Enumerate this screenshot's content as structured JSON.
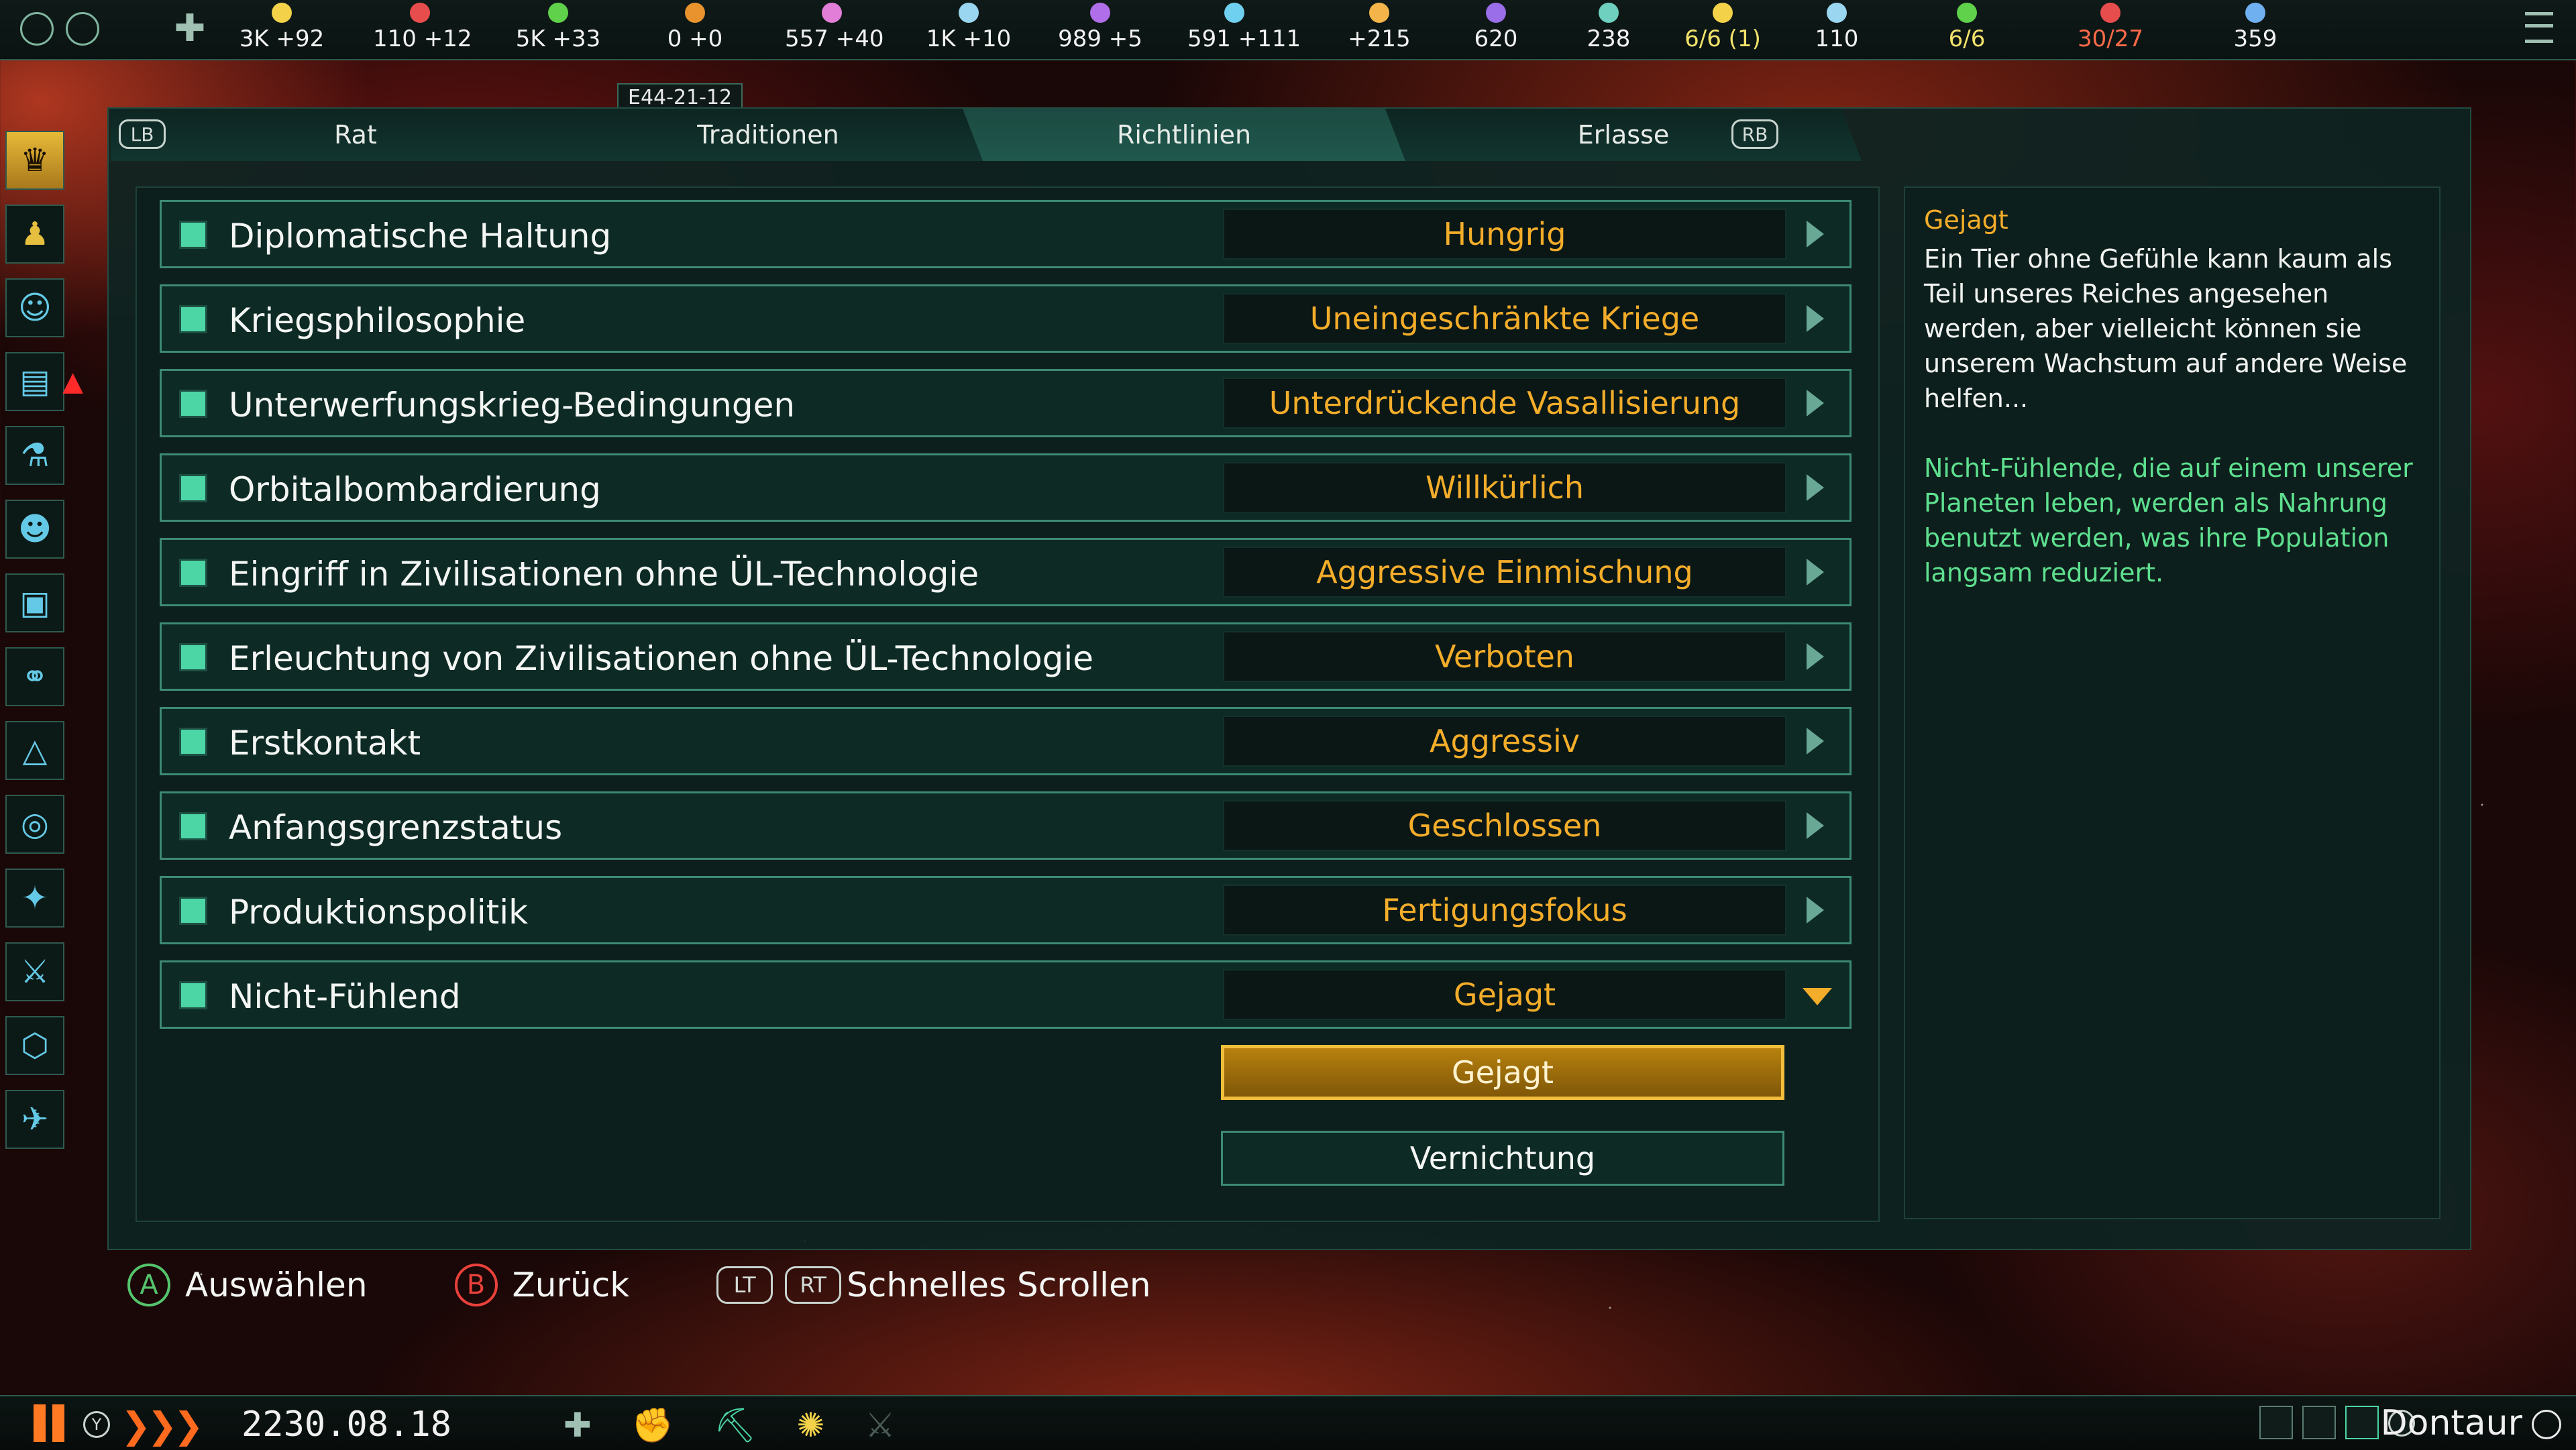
{
  "topbar": {
    "resources": [
      {
        "icon": "energy-icon",
        "text": "3K +92",
        "color": "#f3d24a"
      },
      {
        "icon": "minerals-icon",
        "text": "110 +12",
        "color": "#e84d4d"
      },
      {
        "icon": "food-icon",
        "text": "5K +33",
        "color": "#5fd14a"
      },
      {
        "icon": "consumer-goods-icon",
        "text": "0 +0",
        "color": "#e8932e"
      },
      {
        "icon": "alloys-icon",
        "text": "557 +40",
        "color": "#e27ed8"
      },
      {
        "icon": "influence-icon",
        "text": "1K +10",
        "color": "#9ad6f0"
      },
      {
        "icon": "unity-icon",
        "text": "989 +5",
        "color": "#b06ee8"
      },
      {
        "icon": "research-icon",
        "text": "591 +111",
        "color": "#6fd0f0"
      },
      {
        "icon": "strategic-icon",
        "text": "+215",
        "color": "#f3b54a"
      },
      {
        "icon": "amenities-icon",
        "text": "620",
        "color": "#9a6ee8"
      },
      {
        "icon": "stability-icon",
        "text": "238",
        "color": "#6fd0c0"
      },
      {
        "icon": "envoys-icon",
        "text": "6/6 (1)",
        "color": "#f3d24a"
      },
      {
        "icon": "pops-icon",
        "text": "110",
        "color": "#9ad6f0"
      },
      {
        "icon": "starbase-icon",
        "text": "6/6",
        "color": "#5fd14a"
      },
      {
        "icon": "fleet-icon",
        "text": "30/27",
        "color": "#e84d4d"
      },
      {
        "icon": "naval-icon",
        "text": "359",
        "color": "#6fb0f0"
      }
    ],
    "date_badge": "E44-21-12"
  },
  "tabs": {
    "lb": "LB",
    "rb": "RB",
    "items": [
      {
        "label": "Rat"
      },
      {
        "label": "Traditionen"
      },
      {
        "label": "Richtlinien",
        "active": true
      },
      {
        "label": "Erlasse"
      }
    ]
  },
  "policies": [
    {
      "name": "Diplomatische Haltung",
      "value": "Hungrig"
    },
    {
      "name": "Kriegsphilosophie",
      "value": "Uneingeschränkte Kriege"
    },
    {
      "name": "Unterwerfungskrieg-Bedingungen",
      "value": "Unterdrückende Vasallisierung"
    },
    {
      "name": "Orbitalbombardierung",
      "value": "Willkürlich"
    },
    {
      "name": "Eingriff in Zivilisationen ohne ÜL-Technologie",
      "value": "Aggressive Einmischung"
    },
    {
      "name": "Erleuchtung von Zivilisationen ohne ÜL-Technologie",
      "value": "Verboten"
    },
    {
      "name": "Erstkontakt",
      "value": "Aggressiv"
    },
    {
      "name": "Anfangsgrenzstatus",
      "value": "Geschlossen"
    },
    {
      "name": "Produktionspolitik",
      "value": "Fertigungsfokus"
    },
    {
      "name": "Nicht-Fühlend",
      "value": "Gejagt",
      "expanded": true
    }
  ],
  "dropdown_options": [
    {
      "label": "Gejagt",
      "selected": true
    },
    {
      "label": "Vernichtung",
      "selected": false
    }
  ],
  "description": {
    "title": "Gejagt",
    "text": "Ein Tier ohne Gefühle kann kaum als Teil unseres Reiches angesehen werden, aber vielleicht können sie unserem Wachstum auf andere Weise helfen...",
    "effect": "Nicht-Fühlende, die auf einem unserer Planeten leben, werden als Nahrung benutzt werden, was ihre Population langsam reduziert."
  },
  "hints": {
    "a_key": "A",
    "a_label": "Auswählen",
    "b_key": "B",
    "b_label": "Zurück",
    "lt_key": "LT",
    "rt_key": "RT",
    "scroll_label": "Schnelles Scrollen"
  },
  "bottombar": {
    "y_key": "Y",
    "date": "2230.08.18",
    "x_key": "X",
    "empire": "Dontaur",
    "rs_key": "RS"
  },
  "colors": {
    "accent_orange": "#f4ad2a",
    "accent_green": "#4cd6a5",
    "effect_green": "#5ee08f",
    "panel_bg": "#0d2a25"
  }
}
